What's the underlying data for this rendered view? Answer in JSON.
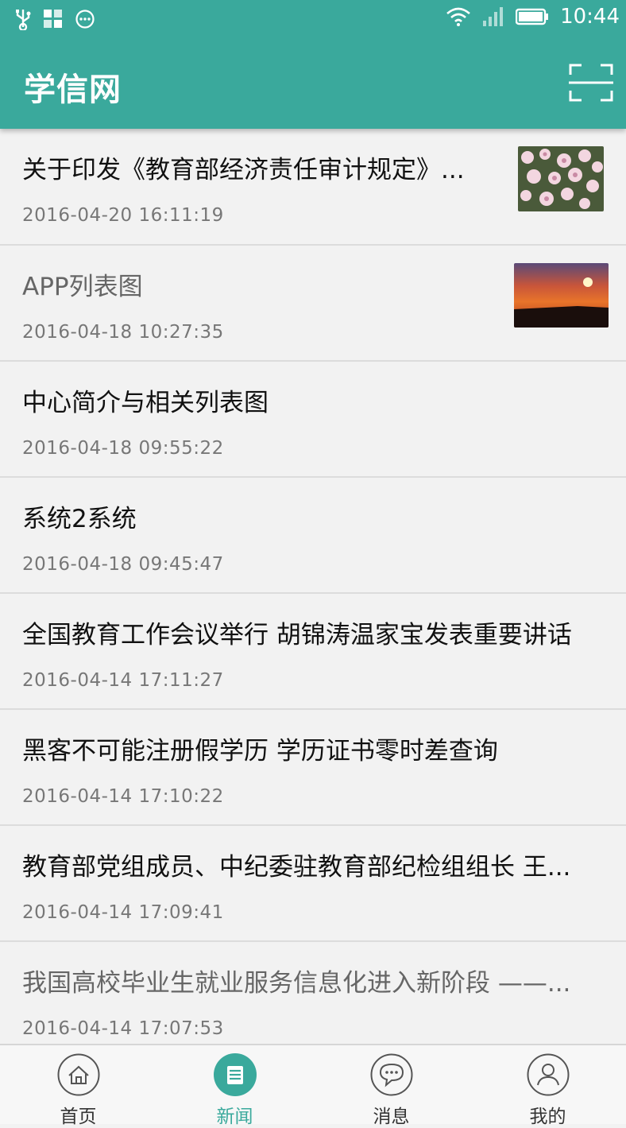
{
  "status_bar": {
    "time": "10:44"
  },
  "header": {
    "title": "学信网"
  },
  "news": [
    {
      "title": "关于印发《教育部经济责任审计规定》...",
      "date": "2016-04-20  16:11:19"
    },
    {
      "title": "APP列表图",
      "date": "2016-04-18  10:27:35"
    },
    {
      "title": "中心简介与相关列表图",
      "date": "2016-04-18  09:55:22"
    },
    {
      "title": "系统2系统",
      "date": "2016-04-18  09:45:47"
    },
    {
      "title": "全国教育工作会议举行 胡锦涛温家宝发表重要讲话",
      "date": "2016-04-14  17:11:27"
    },
    {
      "title": "黑客不可能注册假学历 学历证书零时差查询",
      "date": "2016-04-14  17:10:22"
    },
    {
      "title": "教育部党组成员、中纪委驻教育部纪检组组长  王...",
      "date": "2016-04-14  17:09:41"
    },
    {
      "title": "我国高校毕业生就业服务信息化进入新阶段  ——...",
      "date": "2016-04-14  17:07:53"
    }
  ],
  "tabs": [
    {
      "label": "首页",
      "icon": "home-icon"
    },
    {
      "label": "新闻",
      "icon": "news-icon"
    },
    {
      "label": "消息",
      "icon": "message-icon"
    },
    {
      "label": "我的",
      "icon": "profile-icon"
    }
  ],
  "colors": {
    "accent": "#3aa99c"
  }
}
